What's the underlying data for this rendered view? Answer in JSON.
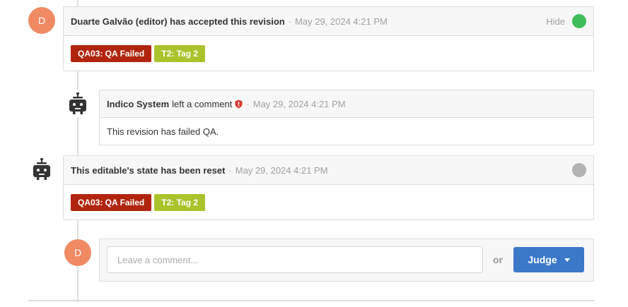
{
  "entries": [
    {
      "avatar_letter": "D",
      "author": "Duarte Galvão (editor) has accepted this revision",
      "separator": "·",
      "timestamp": "May 29, 2024 4:21 PM",
      "hide_label": "Hide",
      "status_color": "#3fbe5b",
      "tags": [
        {
          "label": "QA03: QA Failed",
          "color": "#b1250f"
        },
        {
          "label": "T2: Tag 2",
          "color": "#a9c32b"
        }
      ]
    },
    {
      "author": "Indico System",
      "action": "left a comment",
      "separator": "·",
      "timestamp": "May 29, 2024 4:21 PM",
      "body": "This revision has failed QA."
    },
    {
      "author": "This editable's state has been reset",
      "separator": "·",
      "timestamp": "May 29, 2024 4:21 PM",
      "status_color": "#b3b3b3",
      "tags": [
        {
          "label": "QA03: QA Failed",
          "color": "#b1250f"
        },
        {
          "label": "T2: Tag 2",
          "color": "#a9c32b"
        }
      ]
    }
  ],
  "composer": {
    "avatar_letter": "D",
    "placeholder": "Leave a comment...",
    "or_label": "or",
    "judge_label": "Judge"
  },
  "icons": {
    "robot": "robot-icon",
    "shield": "shield-icon",
    "caret": "caret-down-icon"
  }
}
